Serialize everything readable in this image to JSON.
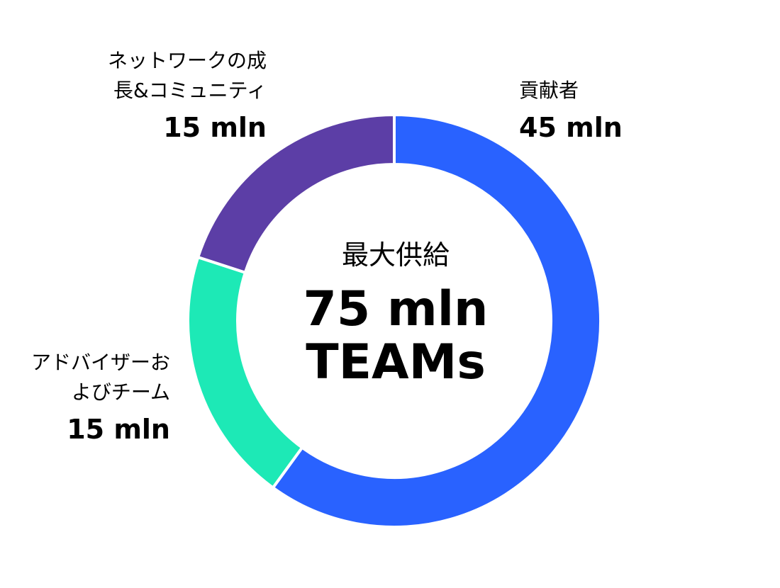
{
  "chart_data": {
    "type": "pie",
    "title": "",
    "center": {
      "caption": "最大供給",
      "value": "75 mln",
      "unit": "TEAMs"
    },
    "slices": [
      {
        "label": "貢献者",
        "value_text": "45 mln",
        "value": 45,
        "color": "#2962ff"
      },
      {
        "label": "アドバイザーおよびチーム",
        "label_lines": [
          "アドバイザーお",
          "よびチーム"
        ],
        "value_text": "15 mln",
        "value": 15,
        "color": "#1de9b6"
      },
      {
        "label": "ネットワークの成長&コミュニティ",
        "label_lines": [
          "ネットワークの成",
          "長&コミュニティ"
        ],
        "value_text": "15 mln",
        "value": 15,
        "color": "#5c3ea6"
      }
    ],
    "total": 75,
    "donut": true
  }
}
